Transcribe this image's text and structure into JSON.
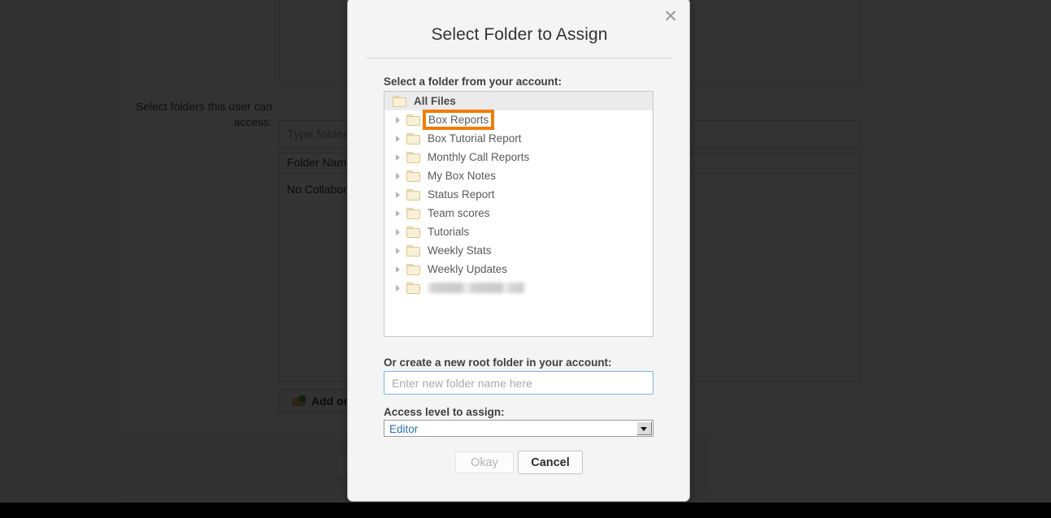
{
  "background": {
    "field_label": "Select folders this user can access:",
    "folder_search_placeholder": "Type folder name",
    "table_header": "Folder Name",
    "table_empty_text": "No Collaborations",
    "add_button_label": "Add or",
    "folder_plus_icon": "folder-add-icon"
  },
  "dialog": {
    "title": "Select Folder to Assign",
    "close_icon": "close-icon",
    "tree_label": "Select a folder from your account:",
    "tree": {
      "root": {
        "label": "All Files",
        "icon": "folder-icon"
      },
      "items": [
        {
          "label": "Box Reports",
          "icon": "folder-icon",
          "twisty": "chevron-right-icon",
          "highlighted": true
        },
        {
          "label": "Box Tutorial Report",
          "icon": "folder-icon",
          "twisty": "chevron-right-icon",
          "highlighted": false
        },
        {
          "label": "Monthly Call Reports",
          "icon": "folder-icon",
          "twisty": "chevron-right-icon",
          "highlighted": false
        },
        {
          "label": "My Box Notes",
          "icon": "folder-icon",
          "twisty": "chevron-right-icon",
          "highlighted": false
        },
        {
          "label": "Status Report",
          "icon": "folder-icon",
          "twisty": "chevron-right-icon",
          "highlighted": false
        },
        {
          "label": "Team scores",
          "icon": "folder-icon",
          "twisty": "chevron-right-icon",
          "highlighted": false
        },
        {
          "label": "Tutorials",
          "icon": "folder-icon",
          "twisty": "chevron-right-icon",
          "highlighted": false
        },
        {
          "label": "Weekly Stats",
          "icon": "folder-icon",
          "twisty": "chevron-right-icon",
          "highlighted": false
        },
        {
          "label": "Weekly Updates",
          "icon": "folder-icon",
          "twisty": "chevron-right-icon",
          "highlighted": false
        },
        {
          "label": "",
          "icon": "folder-icon",
          "twisty": "chevron-right-icon",
          "highlighted": false,
          "redacted": true
        }
      ]
    },
    "new_folder_label": "Or create a new root folder in your account:",
    "new_folder_value": "",
    "new_folder_placeholder": "Enter new folder name here",
    "access_label": "Access level to assign:",
    "access_value": "Editor",
    "access_options": [
      "Editor"
    ],
    "access_dropdown_icon": "caret-down-icon",
    "okay_label": "Okay",
    "okay_disabled": true,
    "cancel_label": "Cancel"
  },
  "colors": {
    "highlight_orange": "#f07d00",
    "select_text_blue": "#2f6ea5",
    "input_focus_border": "#7eb3dd",
    "dialog_bg": "#f4f4f4",
    "overlay": "rgba(0,0,0,0.80)"
  }
}
